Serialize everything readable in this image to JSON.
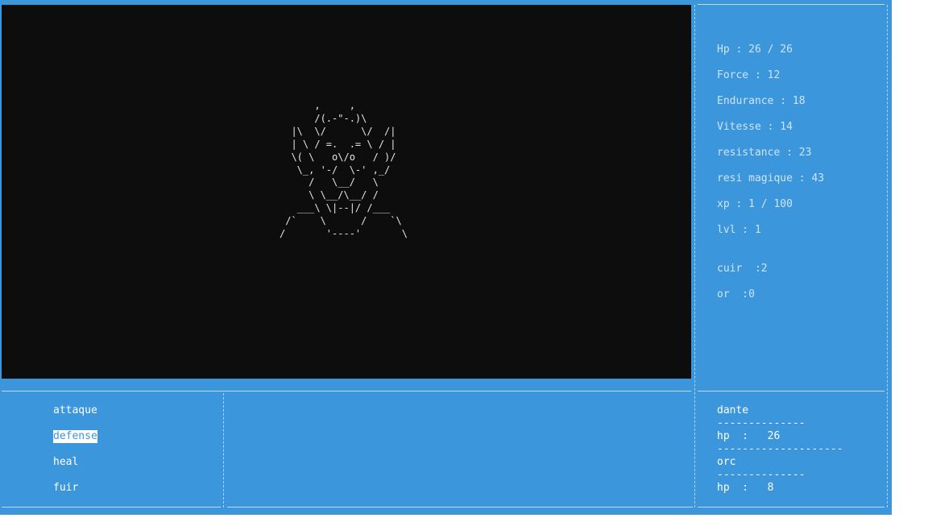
{
  "monster": {
    "art": "      ,     ,\n      /(.-\"-.)\\\n  |\\  \\/      \\/  /|\n  | \\ / =.  .= \\ / |\n  \\( \\   o\\/o   / )/\n   \\_, '-/  \\-' ,_/\n     /   \\__/   \\\n     \\ \\__/\\__/ /\n   ___\\ \\|--|/ /___\n /`    \\      /    `\\\n/       '----'       \\"
  },
  "stats": [
    "Hp : 26 / 26",
    "Force : 12",
    "Endurance : 18",
    "Vitesse : 14",
    "resistance : 23",
    "resi magique : 43",
    "xp : 1 / 100",
    "lvl : 1"
  ],
  "inventory": [
    "cuir  :2",
    "or  :0"
  ],
  "menu": {
    "items": [
      "attaque",
      "defense",
      "heal",
      "fuir"
    ],
    "selected_index": 1
  },
  "combat": {
    "player_name": "dante",
    "separator_short": "--------------",
    "player_hp": "hp  :   26",
    "separator_long": "--------------------",
    "enemy_name": "orc",
    "enemy_hp": "hp  :   8"
  }
}
